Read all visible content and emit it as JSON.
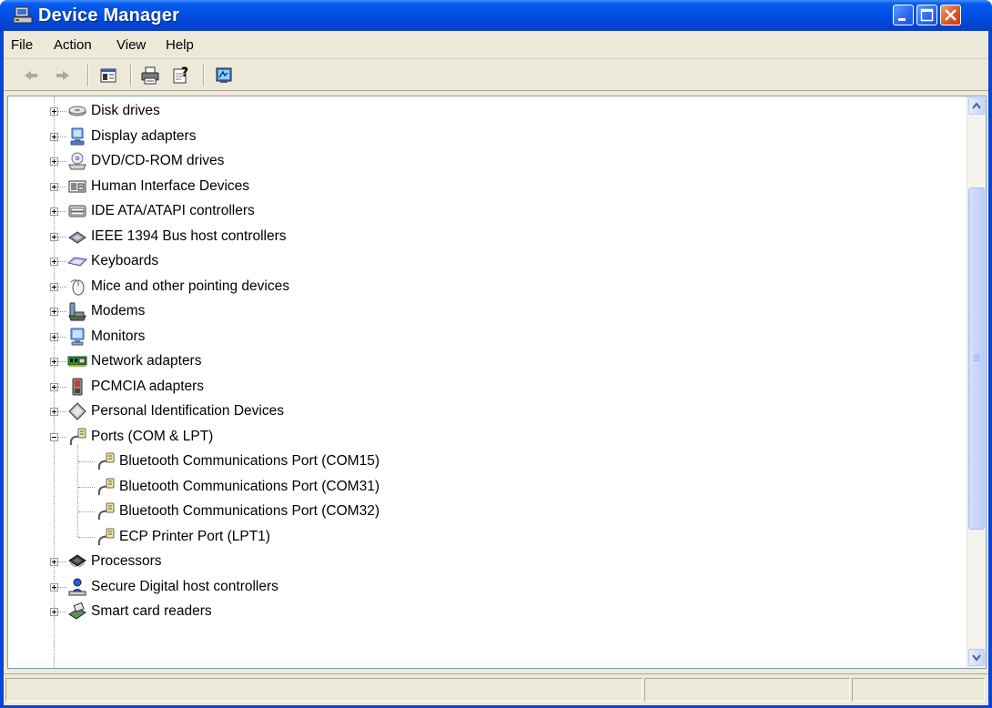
{
  "window": {
    "title": "Device Manager",
    "colors": {
      "titlebar": "#0054e3",
      "close": "#e0552d",
      "client": "#ece9d8"
    }
  },
  "menu": [
    {
      "label": "File"
    },
    {
      "label": "Action"
    },
    {
      "label": "View"
    },
    {
      "label": "Help"
    }
  ],
  "toolbar": {
    "buttons": [
      "back-arrow-icon",
      "forward-arrow-icon",
      "show-hide-console-tree-icon",
      "print-icon",
      "properties-help-icon",
      "scan-hardware-icon"
    ]
  },
  "tree": {
    "nodes": [
      {
        "label": "Disk drives",
        "icon": "disk-drive-icon",
        "expanded": false
      },
      {
        "label": "Display adapters",
        "icon": "display-adapter-icon",
        "expanded": false
      },
      {
        "label": "DVD/CD-ROM drives",
        "icon": "cdrom-drive-icon",
        "expanded": false
      },
      {
        "label": "Human Interface Devices",
        "icon": "hid-icon",
        "expanded": false
      },
      {
        "label": "IDE ATA/ATAPI controllers",
        "icon": "ide-controller-icon",
        "expanded": false
      },
      {
        "label": "IEEE 1394 Bus host controllers",
        "icon": "ieee1394-icon",
        "expanded": false
      },
      {
        "label": "Keyboards",
        "icon": "keyboard-icon",
        "expanded": false
      },
      {
        "label": "Mice and other pointing devices",
        "icon": "mouse-icon",
        "expanded": false
      },
      {
        "label": "Modems",
        "icon": "modem-icon",
        "expanded": false
      },
      {
        "label": "Monitors",
        "icon": "monitor-icon",
        "expanded": false
      },
      {
        "label": "Network adapters",
        "icon": "network-adapter-icon",
        "expanded": false
      },
      {
        "label": "PCMCIA adapters",
        "icon": "pcmcia-icon",
        "expanded": false
      },
      {
        "label": "Personal Identification Devices",
        "icon": "identification-device-icon",
        "expanded": false
      },
      {
        "label": "Ports (COM & LPT)",
        "icon": "port-icon",
        "expanded": true,
        "children": [
          {
            "label": "Bluetooth Communications Port (COM15)",
            "icon": "port-icon"
          },
          {
            "label": "Bluetooth Communications Port (COM31)",
            "icon": "port-icon"
          },
          {
            "label": "Bluetooth Communications Port (COM32)",
            "icon": "port-icon"
          },
          {
            "label": "ECP Printer Port (LPT1)",
            "icon": "port-icon"
          }
        ]
      },
      {
        "label": "Processors",
        "icon": "processor-icon",
        "expanded": false
      },
      {
        "label": "Secure Digital host controllers",
        "icon": "sd-controller-icon",
        "expanded": false
      },
      {
        "label": "Smart card readers",
        "icon": "smart-card-reader-icon",
        "expanded": false
      }
    ]
  }
}
